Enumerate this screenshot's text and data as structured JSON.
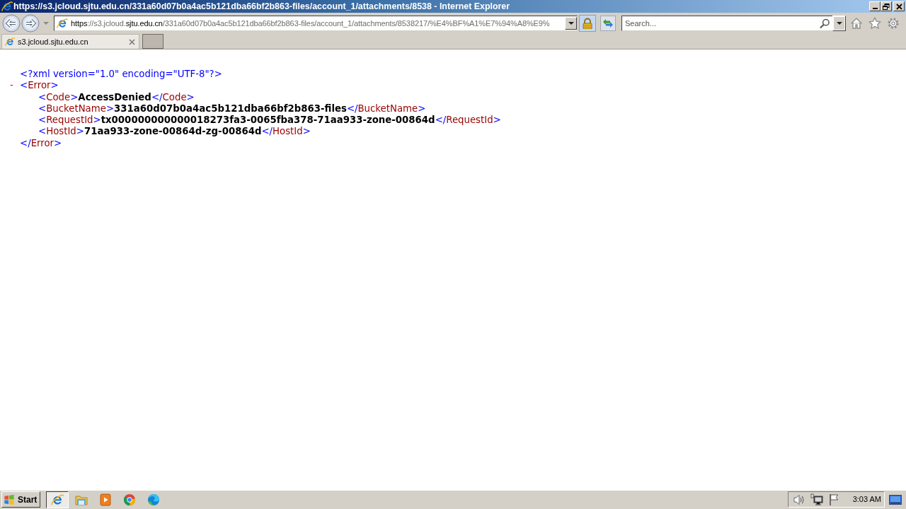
{
  "window": {
    "title": "https://s3.jcloud.sjtu.edu.cn/331a60d07b0a4ac5b121dba66bf2b863-files/account_1/attachments/8538 - Internet Explorer"
  },
  "address_bar": {
    "segments": [
      {
        "text": "https",
        "emphasized": true
      },
      {
        "text": "://s3.jcloud.",
        "emphasized": false
      },
      {
        "text": "sjtu.edu.cn",
        "emphasized": true
      },
      {
        "text": "/331a60d07b0a4ac5b121dba66bf2b863-files/account_1/attachments/8538217/%E4%BF%A1%E7%94%A8%E9%",
        "emphasized": false
      }
    ]
  },
  "search": {
    "placeholder": "Search..."
  },
  "tabs": [
    {
      "label": "s3.jcloud.sjtu.edu.cn",
      "selected": true
    }
  ],
  "document": {
    "declaration": "<?xml version=\"1.0\" encoding=\"UTF-8\"?>",
    "root": {
      "toggle": "-",
      "expanded": true,
      "open_tag": [
        {
          "kind": "markup",
          "text": "<"
        },
        {
          "kind": "name",
          "text": "Error"
        },
        {
          "kind": "markup",
          "text": ">"
        }
      ],
      "children": [
        {
          "tokens": [
            {
              "kind": "markup",
              "text": "<"
            },
            {
              "kind": "name",
              "text": "Code"
            },
            {
              "kind": "markup",
              "text": ">"
            },
            {
              "kind": "value",
              "text": "AccessDenied"
            },
            {
              "kind": "markup",
              "text": "</"
            },
            {
              "kind": "name",
              "text": "Code"
            },
            {
              "kind": "markup",
              "text": ">"
            }
          ]
        },
        {
          "tokens": [
            {
              "kind": "markup",
              "text": "<"
            },
            {
              "kind": "name",
              "text": "BucketName"
            },
            {
              "kind": "markup",
              "text": ">"
            },
            {
              "kind": "value",
              "text": "331a60d07b0a4ac5b121dba66bf2b863-files"
            },
            {
              "kind": "markup",
              "text": "</"
            },
            {
              "kind": "name",
              "text": "BucketName"
            },
            {
              "kind": "markup",
              "text": ">"
            }
          ]
        },
        {
          "tokens": [
            {
              "kind": "markup",
              "text": "<"
            },
            {
              "kind": "name",
              "text": "RequestId"
            },
            {
              "kind": "markup",
              "text": ">"
            },
            {
              "kind": "value",
              "text": "tx000000000000018273fa3-0065fba378-71aa933-zone-00864d"
            },
            {
              "kind": "markup",
              "text": "</"
            },
            {
              "kind": "name",
              "text": "RequestId"
            },
            {
              "kind": "markup",
              "text": ">"
            }
          ]
        },
        {
          "tokens": [
            {
              "kind": "markup",
              "text": "<"
            },
            {
              "kind": "name",
              "text": "HostId"
            },
            {
              "kind": "markup",
              "text": ">"
            },
            {
              "kind": "value",
              "text": "71aa933-zone-00864d-zg-00864d"
            },
            {
              "kind": "markup",
              "text": "</"
            },
            {
              "kind": "name",
              "text": "HostId"
            },
            {
              "kind": "markup",
              "text": ">"
            }
          ]
        }
      ],
      "close_tag": [
        {
          "kind": "markup",
          "text": "</"
        },
        {
          "kind": "name",
          "text": "Error"
        },
        {
          "kind": "markup",
          "text": ">"
        }
      ]
    }
  },
  "taskbar": {
    "start_label": "Start",
    "apps": [
      {
        "kind": "ie",
        "active": true
      },
      {
        "kind": "folder",
        "active": false
      },
      {
        "kind": "media",
        "active": false
      },
      {
        "kind": "chrome",
        "active": false
      },
      {
        "kind": "edge",
        "active": false
      }
    ],
    "clock": "3:03 AM"
  }
}
